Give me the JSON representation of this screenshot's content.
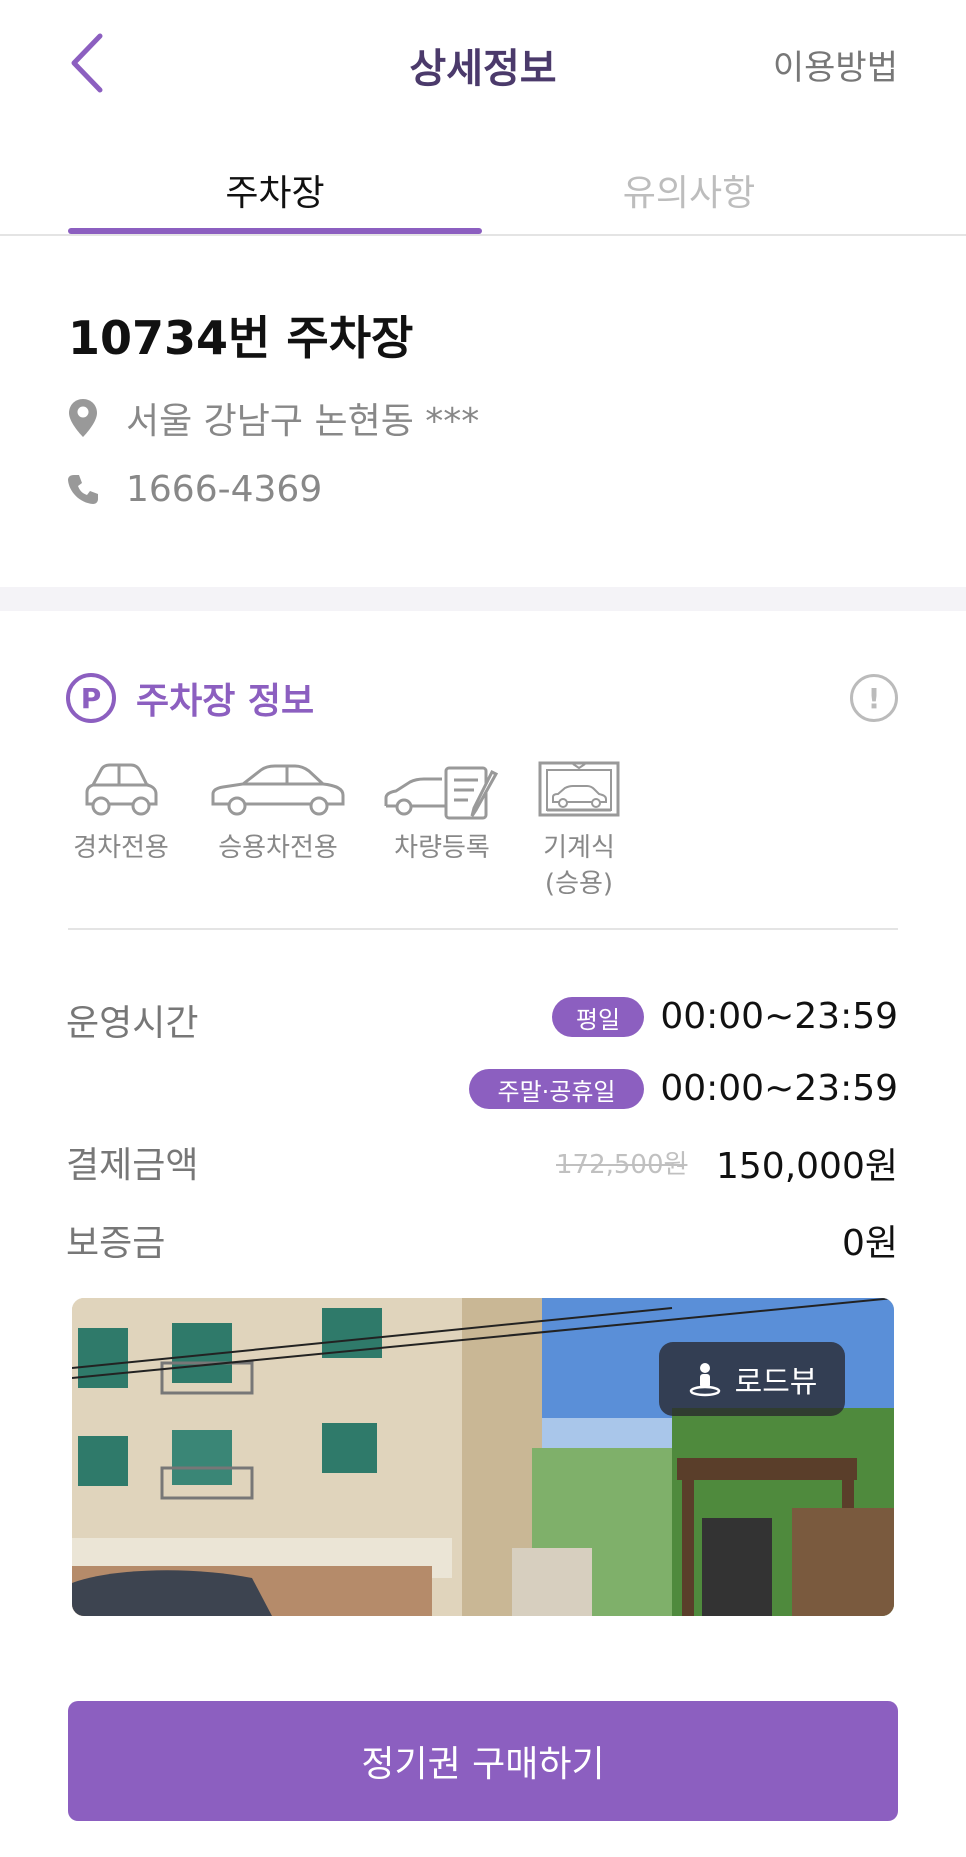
{
  "header": {
    "title": "상세정보",
    "help_label": "이용방법",
    "accent": "#8c5fc0"
  },
  "tabs": [
    {
      "label": "주차장",
      "active": true
    },
    {
      "label": "유의사항",
      "active": false
    }
  ],
  "lot": {
    "name": "10734번 주차장",
    "address": "서울 강남구 논현동 ***",
    "phone": "1666-4369"
  },
  "section": {
    "badge": "P",
    "title": "주차장 정보"
  },
  "features": [
    {
      "icon": "compact-car-icon",
      "label": "경차전용"
    },
    {
      "icon": "sedan-car-icon",
      "label": "승용차전용"
    },
    {
      "icon": "car-registration-icon",
      "label": "차량등록"
    },
    {
      "icon": "mechanical-parking-icon",
      "label": "기계식",
      "sublabel": "(승용)"
    }
  ],
  "details": {
    "hours_label": "운영시간",
    "weekday_badge": "평일",
    "weekday_hours": "00:00~23:59",
    "weekend_badge": "주말·공휴일",
    "weekend_hours": "00:00~23:59",
    "payment_label": "결제금액",
    "original_price": "172,500원",
    "price": "150,000원",
    "deposit_label": "보증금",
    "deposit": "0원"
  },
  "photo": {
    "roadview_label": "로드뷰"
  },
  "cta": {
    "label": "정기권 구매하기"
  }
}
